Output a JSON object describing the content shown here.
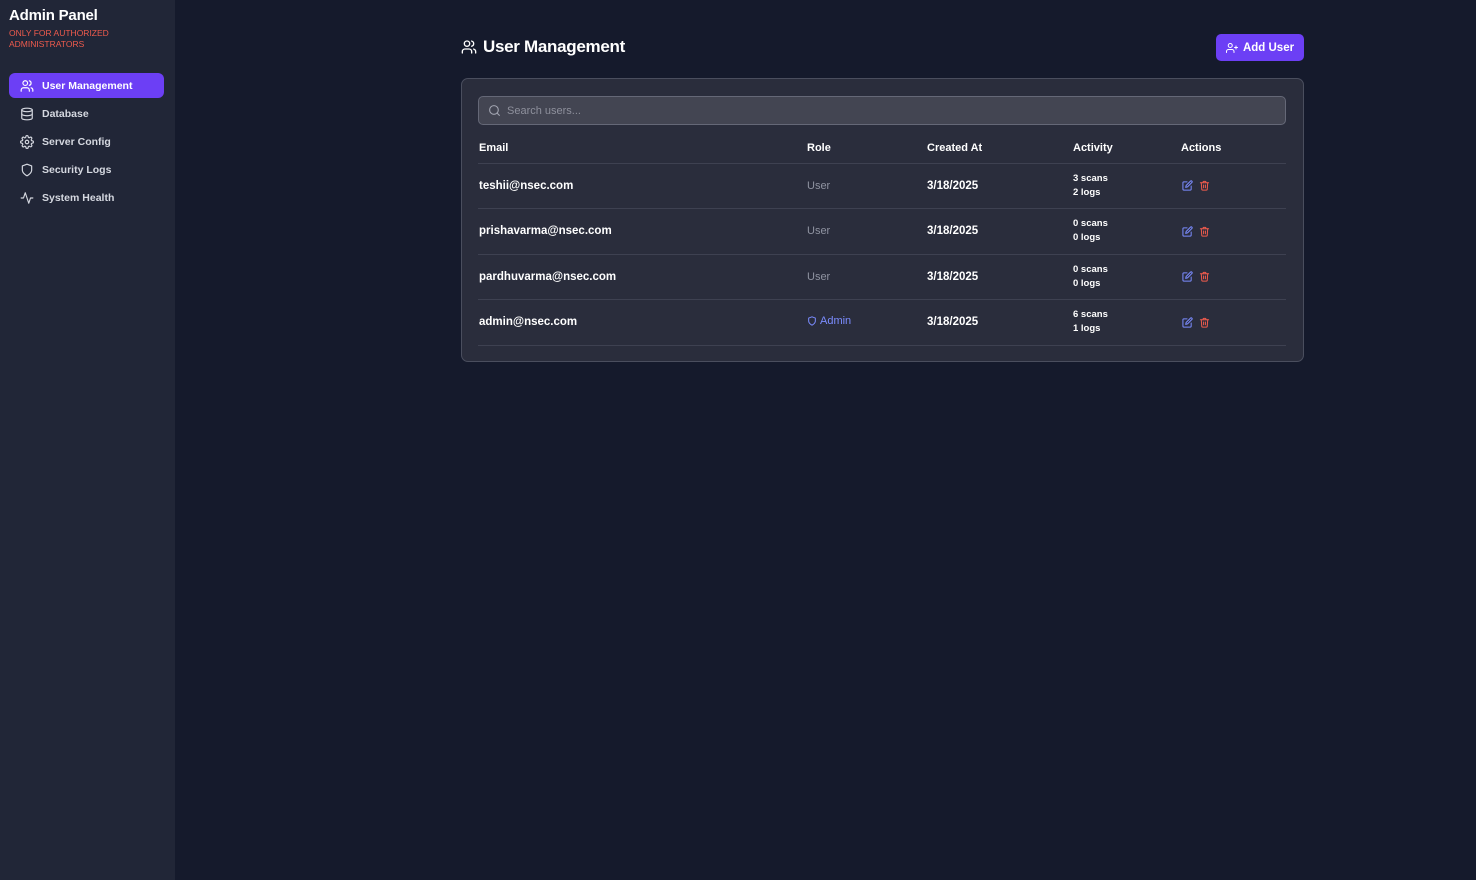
{
  "sidebar": {
    "title": "Admin Panel",
    "subtitle": "ONLY FOR AUTHORIZED ADMINISTRATORS",
    "items": [
      {
        "label": "User Management",
        "icon": "users-icon",
        "active": true
      },
      {
        "label": "Database",
        "icon": "database-icon",
        "active": false
      },
      {
        "label": "Server Config",
        "icon": "gear-icon",
        "active": false
      },
      {
        "label": "Security Logs",
        "icon": "shield-icon",
        "active": false
      },
      {
        "label": "System Health",
        "icon": "activity-icon",
        "active": false
      }
    ]
  },
  "header": {
    "title": "User Management",
    "add_button_label": "Add User"
  },
  "search": {
    "placeholder": "Search users...",
    "value": ""
  },
  "table": {
    "columns": [
      "Email",
      "Role",
      "Created At",
      "Activity",
      "Actions"
    ],
    "rows": [
      {
        "email": "teshii@nsec.com",
        "role": "User",
        "created": "3/18/2025",
        "scans": "3 scans",
        "logs": "2 logs"
      },
      {
        "email": "prishavarma@nsec.com",
        "role": "User",
        "created": "3/18/2025",
        "scans": "0 scans",
        "logs": "0 logs"
      },
      {
        "email": "pardhuvarma@nsec.com",
        "role": "User",
        "created": "3/18/2025",
        "scans": "0 scans",
        "logs": "0 logs"
      },
      {
        "email": "admin@nsec.com",
        "role": "Admin",
        "created": "3/18/2025",
        "scans": "6 scans",
        "logs": "1 logs"
      }
    ]
  },
  "colors": {
    "accent": "#6c3ff5",
    "danger": "#ef5b4d",
    "admin": "#7b8cff",
    "edit": "#7b8cff",
    "delete": "#ef5b4d"
  }
}
